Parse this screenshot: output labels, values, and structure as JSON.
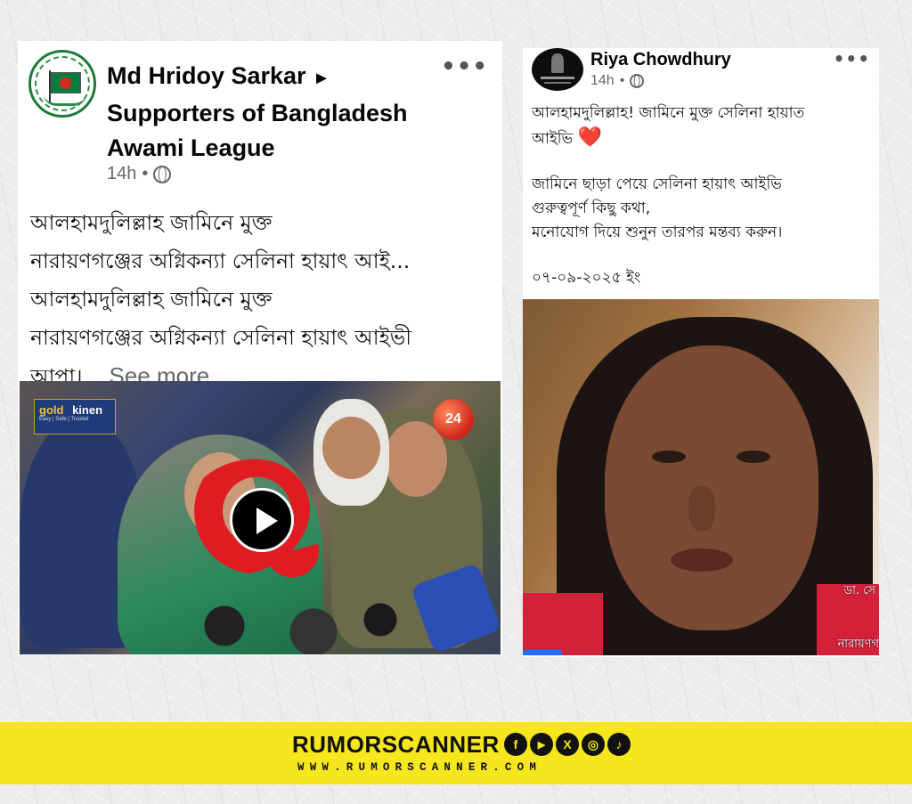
{
  "post1": {
    "author": "Md Hridoy Sarkar",
    "arrow": "►",
    "group": "Supporters of Bangladesh Awami League",
    "time": "14h",
    "separator": "•",
    "more_icon": "•••",
    "line1": "আলহামদুলিল্লাহ জামিনে মুক্ত",
    "line2": "নারায়ণগঞ্জের অগ্নিকন্যা সেলিনা হায়াৎ আই...",
    "line3": "আলহামদুলিল্লাহ জামিনে মুক্ত",
    "line4": "নারায়ণগঞ্জের অগ্নিকন্যা সেলিনা হায়াৎ আইভী",
    "line5": "আপা।...",
    "see_more": "See more",
    "video": {
      "overlay_brand": "gold",
      "overlay_brand2": "kinen",
      "overlay_tagline": "Easy | Safe | Trusted",
      "channel_badge": "24"
    }
  },
  "post2": {
    "author": "Riya Chowdhury",
    "time": "14h",
    "separator": "•",
    "more_icon": "•••",
    "para1_line1": "আলহামদুলিল্লাহ!  জামিনে মুক্ত সেলিনা হায়াত",
    "para1_line2": "আইভি",
    "heart": "❤️",
    "para2_line1": "জামিনে ছাড়া পেয়ে সেলিনা হায়াৎ আইভি",
    "para2_line2": "গুরুত্বপূর্ণ কিছু কথা,",
    "para2_line3": "মনোযোগ দিয়ে শুনুন তারপর মন্তব্য করুন।",
    "date": "০৭-০৯-২০২৫ ইং",
    "video": {
      "caption1": "ডা. সে",
      "caption2": "নারায়ণগ"
    }
  },
  "footer": {
    "brand": "RUMORSCANNER",
    "url": "WWW.RUMORSCANNER.COM",
    "social_icons": [
      {
        "name": "facebook-icon",
        "glyph": "f"
      },
      {
        "name": "youtube-icon",
        "glyph": "▶"
      },
      {
        "name": "x-icon",
        "glyph": "X"
      },
      {
        "name": "instagram-icon",
        "glyph": "◎"
      },
      {
        "name": "tiktok-icon",
        "glyph": "♪"
      }
    ],
    "colors": {
      "band": "#f5e61d",
      "text": "#111111"
    }
  }
}
